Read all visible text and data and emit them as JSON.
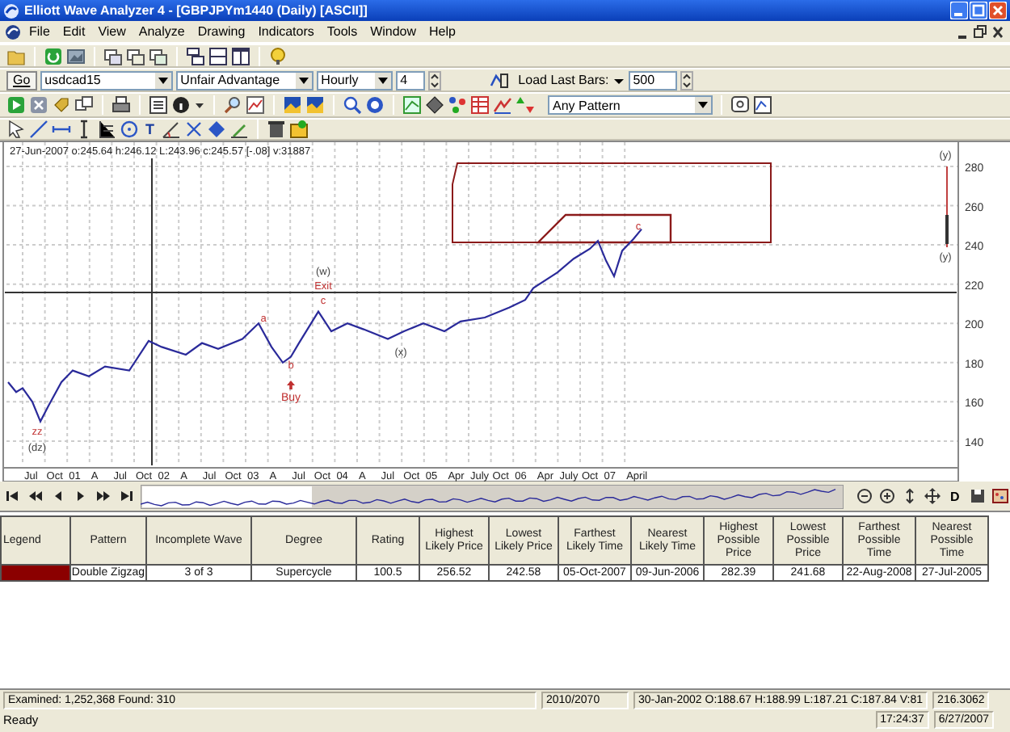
{
  "window": {
    "title": "Elliott Wave Analyzer 4 - [GBPJPYm1440 (Daily) [ASCII]]"
  },
  "menu": [
    "File",
    "Edit",
    "View",
    "Analyze",
    "Drawing",
    "Indicators",
    "Tools",
    "Window",
    "Help"
  ],
  "symbol_bar": {
    "go": "Go",
    "symbol": "usdcad15",
    "system": "Unfair Advantage",
    "timeframe": "Hourly",
    "count": "4",
    "load_label": "Load Last Bars:",
    "load_count": "500"
  },
  "pattern_filter": "Any Pattern",
  "text_tool": "T",
  "chart": {
    "info": "27-Jun-2007  o:245.64 h:246.12 L:243.96 c:245.57 [-.08] v:31887",
    "price_ticks": [
      "280",
      "260",
      "240",
      "220",
      "200",
      "180",
      "160",
      "140"
    ],
    "time_labels": [
      "Jul",
      "Oct",
      "01",
      "A",
      "Jul",
      "Oct",
      "02",
      "A",
      "Jul",
      "Oct",
      "03",
      "A",
      "Jul",
      "Oct",
      "04",
      "A",
      "Jul",
      "Oct",
      "05",
      "Apr",
      "July",
      "Oct",
      "06",
      "Apr",
      "July",
      "Oct",
      "07",
      "April"
    ],
    "annotations": [
      {
        "text": "(w)",
        "kind": "major"
      },
      {
        "text": "Exit",
        "kind": "minor"
      },
      {
        "text": "c",
        "kind": "minor"
      },
      {
        "text": "a",
        "kind": "minor"
      },
      {
        "text": "b",
        "kind": "minor"
      },
      {
        "text": "Buy",
        "kind": "minor"
      },
      {
        "text": "(x)",
        "kind": "major"
      },
      {
        "text": "zz",
        "kind": "minor"
      },
      {
        "text": "(dz)",
        "kind": "major"
      },
      {
        "text": "(y)",
        "kind": "major"
      },
      {
        "text": "(y)",
        "kind": "major"
      },
      {
        "text": "c",
        "kind": "minor"
      }
    ]
  },
  "navigator": {
    "detail_button": "D"
  },
  "table": {
    "columns": [
      "Legend",
      "Pattern",
      "Incomplete Wave",
      "Degree",
      "Rating",
      "Highest Likely Price",
      "Lowest Likely Price",
      "Farthest Likely Time",
      "Nearest Likely Time",
      "Highest Possible Price",
      "Lowest Possible Price",
      "Farthest Possible Time",
      "Nearest Possible Time"
    ],
    "rows": [
      {
        "color": "#8b0000",
        "cells": [
          "",
          "Double Zigzag",
          "3 of 3",
          "Supercycle",
          "100.5",
          "256.52",
          "242.58",
          "05-Oct-2007",
          "09-Jun-2006",
          "282.39",
          "241.68",
          "22-Aug-2008",
          "27-Jul-2005"
        ]
      }
    ]
  },
  "status_bar": {
    "examined": "Examined: 1,252,368  Found: 310",
    "progress": "2010/2070",
    "bar_info": "30-Jan-2002  O:188.67 H:188.99 L:187.21 C:187.84 V:81",
    "value": "216.3062",
    "state": "Ready",
    "time": "17:24:37",
    "date": "6/27/2007"
  }
}
